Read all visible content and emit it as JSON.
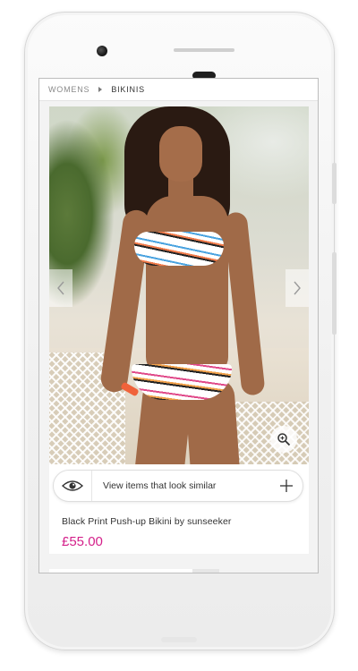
{
  "breadcrumb": {
    "items": [
      "WOMENS",
      "BIKINIS"
    ]
  },
  "product": {
    "name": "Black Print Push-up Bikini by sunseeker",
    "price": "£55.00",
    "similar_label": "View items that look similar"
  },
  "icons": {
    "prev": "chevron-left-icon",
    "next": "chevron-right-icon",
    "zoom": "zoom-icon",
    "eye": "eye-icon",
    "plus": "plus-icon"
  },
  "colors": {
    "price": "#d4208a",
    "text": "#333333",
    "breadcrumb_muted": "#8a8a8a"
  }
}
